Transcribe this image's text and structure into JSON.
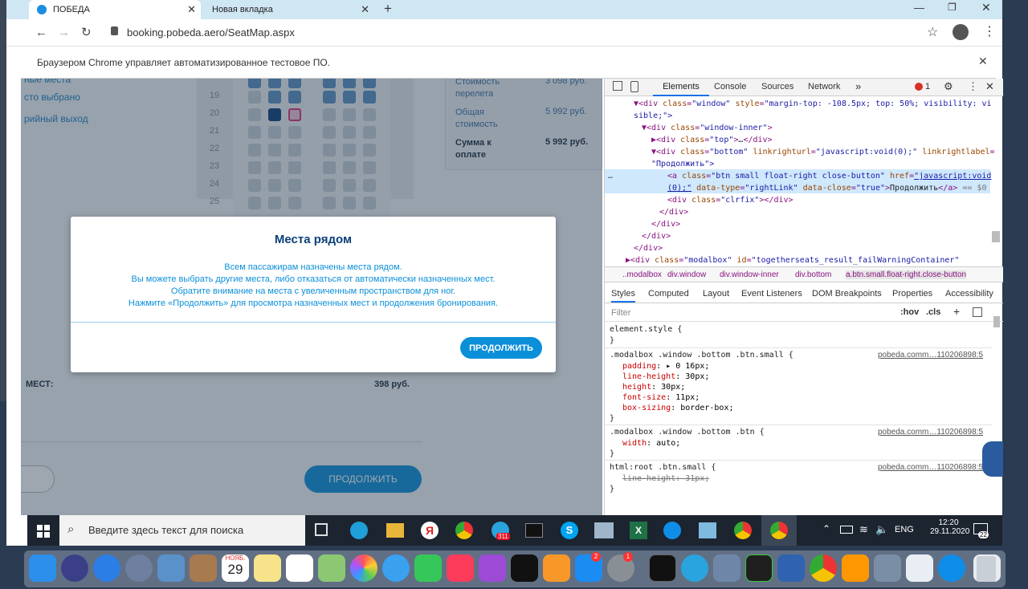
{
  "browser": {
    "tabs": [
      {
        "label": "ПОБЕДА",
        "active": true
      },
      {
        "label": "Новая вкладка",
        "active": false
      }
    ],
    "url": "booking.pobeda.aero/SeatMap.aspx",
    "infobar_text": "Браузером Chrome управляет автоматизированное тестовое ПО."
  },
  "page": {
    "sidebar_items": [
      "ные места",
      "сто выбрано",
      "рийный выход"
    ],
    "rows": [
      "19",
      "20",
      "21",
      "22",
      "23",
      "24",
      "25"
    ],
    "price_box": {
      "rows": [
        {
          "label": "Стоимость перелета",
          "value": "3 098 руб."
        },
        {
          "label": "Общая стоимость",
          "value": "5 992 руб."
        },
        {
          "label": "Сумма к оплате",
          "value": "5 992 руб."
        }
      ]
    },
    "places_label": "МЕСТ:",
    "places_price": "398 руб.",
    "continue_bottom": "ПРОДОЛЖИТЬ"
  },
  "modal": {
    "title": "Места рядом",
    "lines": [
      "Всем пассажирам назначены места рядом.",
      "Вы можете выбрать другие места, либо отказаться от автоматически назначенных мест.",
      "Обратите внимание на места с увеличенным пространством для ног.",
      "Нажмите «Продолжить» для просмотра назначенных мест и продолжения бронирования."
    ],
    "button": "ПРОДОЛЖИТЬ"
  },
  "devtools": {
    "tabs": [
      "Elements",
      "Console",
      "Sources",
      "Network"
    ],
    "error_count": "1",
    "breadcrumbs": [
      "..modalbox",
      "div.window",
      "div.window-inner",
      "div.bottom",
      "a.btn.small.float-right.close-button"
    ],
    "pane_tabs": [
      "Styles",
      "Computed",
      "Layout",
      "Event Listeners",
      "DOM Breakpoints",
      "Properties",
      "Accessibility"
    ],
    "filter_placeholder": "Filter",
    "hov": ":hov",
    "cls": ".cls",
    "source_link": "pobeda.comm…110206898:5"
  },
  "taskbar": {
    "search_placeholder": "Введите здесь текст для поиска",
    "lang": "ENG",
    "time": "12:20",
    "date": "29.11.2020",
    "notif_count": "22",
    "badge": "311"
  },
  "dock": {
    "calendar_month": "НОЯБ.",
    "calendar_day": "29",
    "badge_appstore": "2",
    "badge_settings": "1"
  },
  "colors": {
    "brand": "#0b8fd9",
    "brand_dark": "#0a3f7a",
    "accent_pink": "#d6317b"
  }
}
